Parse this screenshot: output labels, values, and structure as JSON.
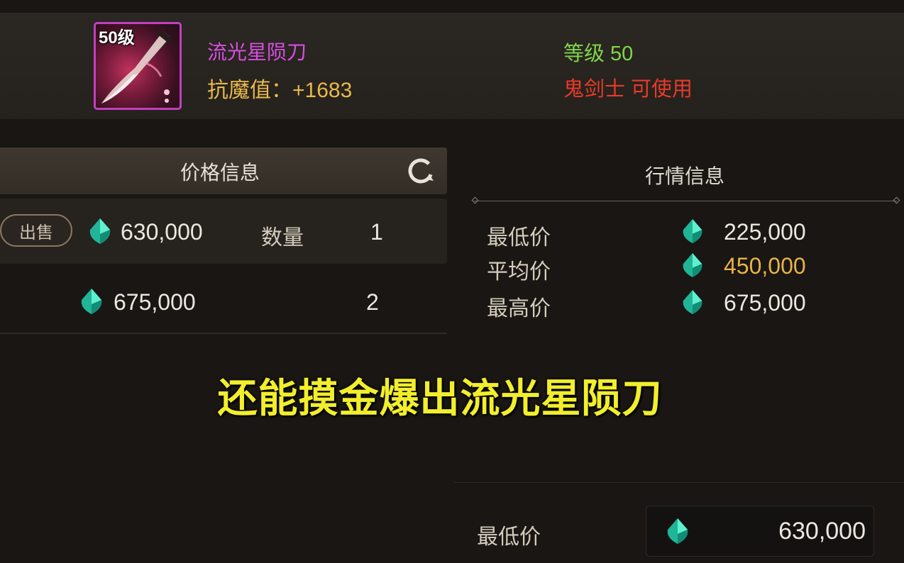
{
  "item": {
    "level_badge": "50级",
    "name": "流光星陨刀",
    "stat": "抗魔值：+1683",
    "required_level": "等级 50",
    "class_requirement": "鬼剑士 可使用",
    "rarity_color": "#c23fc0"
  },
  "price_panel": {
    "title": "价格信息",
    "refresh_icon": "refresh-icon",
    "sell_button": "出售",
    "quantity_label": "数量",
    "listings": [
      {
        "price": "630,000",
        "quantity": "1"
      },
      {
        "price": "675,000",
        "quantity": "2"
      }
    ]
  },
  "market_panel": {
    "title": "行情信息",
    "rows": [
      {
        "label": "最低价",
        "value": "225,000"
      },
      {
        "label": "平均价",
        "value": "450,000"
      },
      {
        "label": "最高价",
        "value": "675,000"
      }
    ]
  },
  "sell_form": {
    "label": "最低价",
    "price_value": "630,000"
  },
  "caption": "还能摸金爆出流光星陨刀",
  "colors": {
    "item_name": "#d64fe0",
    "stat": "#e8b94c",
    "level": "#7fd64a",
    "class": "#e83b2a",
    "average_price": "#e7b447",
    "caption": "#f2ee2c",
    "gem": "#2fd3b0"
  }
}
